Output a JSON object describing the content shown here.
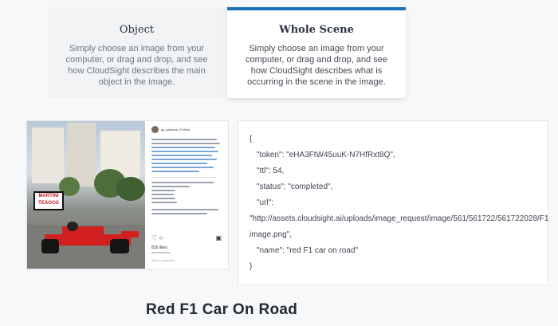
{
  "mode_cards": [
    {
      "title": "Object",
      "description": "Simply choose an image from your computer, or drag and drop, and see how CloudSight describes the main object in the image."
    },
    {
      "title": "Whole Scene",
      "description": "Simply choose an image from your computer, or drag and drop, and see how CloudSight describes what is occurring in the scene in the image."
    }
  ],
  "image_panel": {
    "instagram_header": "gp_pictures • Follow",
    "martini_sign": "MARTINI TEAOCO",
    "likes": "816 likes",
    "comment_placeholder": "Add a comment..."
  },
  "json_result": {
    "open_brace": "{",
    "token_line": "\"token\": \"eHA3FtW45uuK-N7HfRxt8Q\",",
    "ttl_line": "\"ttl\": 54,",
    "status_line": "\"status\": \"completed\",",
    "url_key_line": "\"url\":",
    "url_value_line": "\"http://assets.cloudsight.ai/uploads/image_request/image/561/561722/561722028/F1 image.png\",",
    "name_line": "\"name\": \"red F1 car on road\"",
    "close_brace": "}"
  },
  "result_caption": "Red F1 Car On Road",
  "colors": {
    "accent": "#1a72b8",
    "page_background": "#f7f8fa"
  }
}
